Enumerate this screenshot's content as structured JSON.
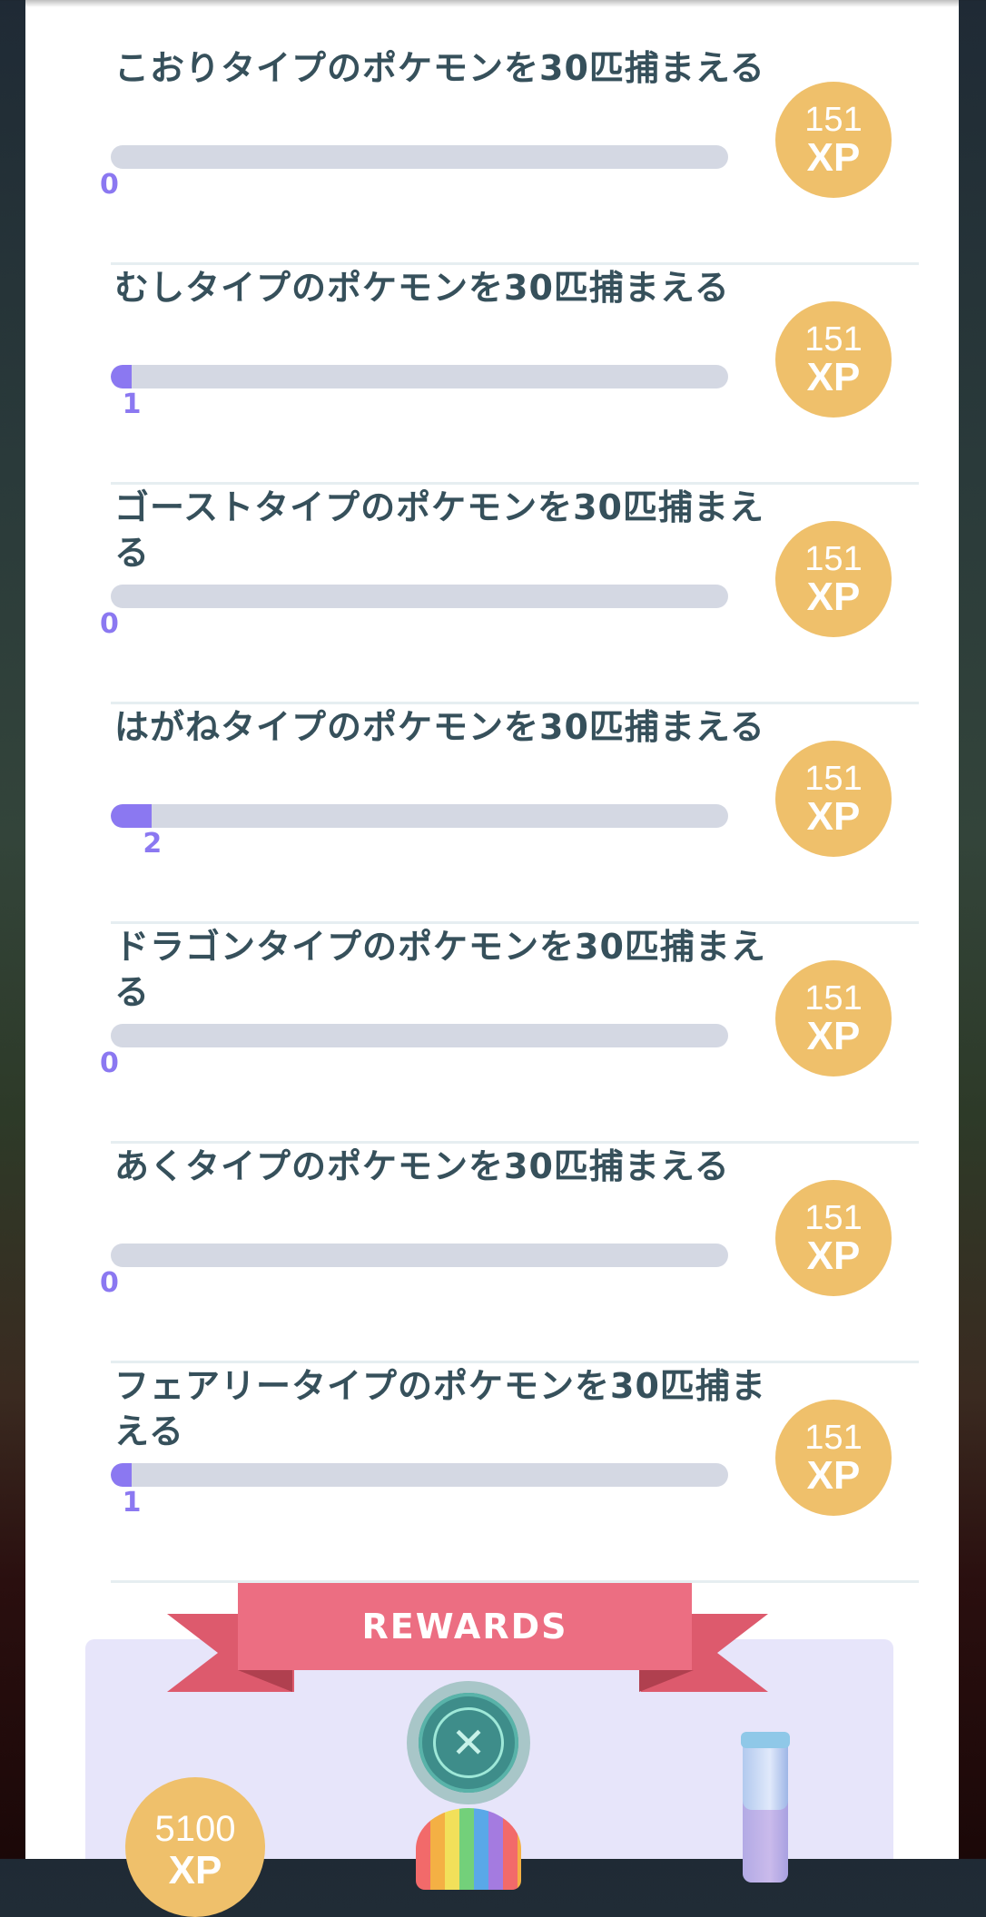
{
  "tasks": [
    {
      "title": "こおりタイプのポケモンを30匹捕まえる",
      "progress": 0,
      "progress_label": "0",
      "reward_amount": "151",
      "reward_unit": "XP"
    },
    {
      "title": "むしタイプのポケモンを30匹捕まえる",
      "progress": 1,
      "progress_label": "1",
      "reward_amount": "151",
      "reward_unit": "XP"
    },
    {
      "title": "ゴーストタイプのポケモンを30匹捕まえる",
      "progress": 0,
      "progress_label": "0",
      "reward_amount": "151",
      "reward_unit": "XP"
    },
    {
      "title": "はがねタイプのポケモンを30匹捕まえる",
      "progress": 2,
      "progress_label": "2",
      "reward_amount": "151",
      "reward_unit": "XP"
    },
    {
      "title": "ドラゴンタイプのポケモンを30匹捕まえる",
      "progress": 0,
      "progress_label": "0",
      "reward_amount": "151",
      "reward_unit": "XP"
    },
    {
      "title": "あくタイプのポケモンを30匹捕まえる",
      "progress": 0,
      "progress_label": "0",
      "reward_amount": "151",
      "reward_unit": "XP"
    },
    {
      "title": "フェアリータイプのポケモンを30匹捕まえる",
      "progress": 1,
      "progress_label": "1",
      "reward_amount": "151",
      "reward_unit": "XP"
    }
  ],
  "rewards": {
    "banner_label": "REWARDS",
    "xp_amount": "5100",
    "xp_unit": "XP",
    "items": [
      "xp-icon",
      "incense-icon",
      "potion-vial-icon"
    ]
  },
  "colors": {
    "progress_fill": "#8b78f1",
    "progress_track": "#d4d8e3",
    "xp_badge": "#efc06b",
    "ribbon": "#ec6e82",
    "title_text": "#36505b"
  }
}
